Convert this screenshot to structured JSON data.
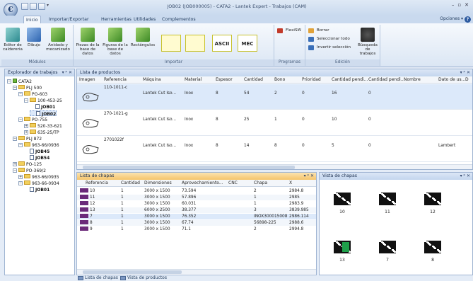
{
  "window": {
    "title": "JOB02 (JOB000005) - CATA2 - Lantek Expert - Trabajos (CAM)",
    "controls": [
      "–",
      "▫",
      "✕"
    ]
  },
  "qat": {
    "items": [
      "save-icon",
      "new-icon",
      "print-icon"
    ]
  },
  "ribbon_tabs": [
    "Inicio",
    "Importar/Exportar",
    "Herramientas",
    "Utilidades",
    "Complementos"
  ],
  "options_label": "Opciones",
  "help_label": "?",
  "groups": {
    "modulos": {
      "label": "Módulos",
      "buttons": [
        {
          "label": "Editor de\ncaldereria",
          "icon": "boiler-editor-icon"
        },
        {
          "label": "Dibujo",
          "icon": "drawing-icon"
        },
        {
          "label": "Anidado y\nmecanizado",
          "icon": "nesting-icon"
        }
      ]
    },
    "importar": {
      "label": "Importar",
      "buttons": [
        {
          "label": "Piezas de la\nbase de datos",
          "icon": "db-parts-icon"
        },
        {
          "label": "Figuras de la\nbase de datos",
          "icon": "db-figures-icon"
        },
        {
          "label": "Rectángulos",
          "icon": "rectangles-icon"
        }
      ],
      "big_icons": [
        "",
        "",
        "ASCII",
        "MEC"
      ]
    },
    "programas": {
      "label": "Programas",
      "flexsw": "FlexiSW"
    },
    "edicion": {
      "label": "Edición",
      "buttons": [
        "Borrar",
        "Seleccionar todo",
        "Invertir selección"
      ],
      "search": "Búsqueda de\ntrabajos"
    }
  },
  "explorer": {
    "title": "Explorador de trabajos",
    "nodes": [
      {
        "label": "CATA2",
        "level": 0,
        "type": "root",
        "exp": "−"
      },
      {
        "label": "PLJ 500",
        "level": 1,
        "type": "folder",
        "exp": "−"
      },
      {
        "label": "PO-603",
        "level": 2,
        "type": "folder",
        "exp": "−"
      },
      {
        "label": "100-453-25",
        "level": 3,
        "type": "folder",
        "exp": "−"
      },
      {
        "label": "JOB01",
        "level": 4,
        "type": "doc",
        "bold": true
      },
      {
        "label": "JOB02",
        "level": 4,
        "type": "doc",
        "bold": true,
        "selected": true
      },
      {
        "label": "PO-755",
        "level": 2,
        "type": "folder",
        "exp": "−"
      },
      {
        "label": "520-33-621",
        "level": 3,
        "type": "folder",
        "exp": "+"
      },
      {
        "label": "635-25/TP",
        "level": 3,
        "type": "folder",
        "exp": "+"
      },
      {
        "label": "PLJ 872",
        "level": 1,
        "type": "folder",
        "exp": "−"
      },
      {
        "label": "963-66/0936",
        "level": 2,
        "type": "folder",
        "exp": "−"
      },
      {
        "label": "JOB45",
        "level": 3,
        "type": "doc",
        "bold": true
      },
      {
        "label": "JOB54",
        "level": 3,
        "type": "doc",
        "bold": true
      },
      {
        "label": "PO-125",
        "level": 1,
        "type": "folder",
        "exp": "+"
      },
      {
        "label": "PO-369/2",
        "level": 1,
        "type": "folder",
        "exp": "−"
      },
      {
        "label": "963-66/0935",
        "level": 2,
        "type": "folder",
        "exp": "+"
      },
      {
        "label": "963-66-0934",
        "level": 2,
        "type": "folder",
        "exp": "−"
      },
      {
        "label": "JOB01",
        "level": 3,
        "type": "doc",
        "bold": true
      }
    ]
  },
  "products": {
    "title": "Lista de productos",
    "columns": [
      "Imagen",
      "Referencia",
      "Máquina",
      "Material",
      "Espesor",
      "Cantidad",
      "Bono",
      "Prioridad",
      "Cantidad pendi...",
      "Cantidad pendi...",
      "Nombre",
      "Dato de us...",
      "D"
    ],
    "rows": [
      {
        "ref": "110-1011-c",
        "maquina": "Lantek Cut Iso...",
        "material": "Inox",
        "espesor": "8",
        "cantidad": "54",
        "bono": "2",
        "prioridad": "0",
        "pend1": "16",
        "pend2": "0",
        "nombre": "",
        "dato": ""
      },
      {
        "ref": "270-1021-g",
        "maquina": "Lantek Cut Iso...",
        "material": "Inox",
        "espesor": "8",
        "cantidad": "25",
        "bono": "1",
        "prioridad": "0",
        "pend1": "10",
        "pend2": "0",
        "nombre": "",
        "dato": ""
      },
      {
        "ref": "2701022f",
        "maquina": "Lantek Cut Iso...",
        "material": "Inox",
        "espesor": "8",
        "cantidad": "14",
        "bono": "8",
        "prioridad": "0",
        "pend1": "5",
        "pend2": "0",
        "nombre": "",
        "dato": "Lambert"
      }
    ]
  },
  "sheets": {
    "title": "Lista de chapas",
    "columns": [
      "Referencia",
      "Cantidad",
      "Dimensiones",
      "Aprovechamiento...",
      "CNC",
      "Chapa",
      "X"
    ],
    "rows": [
      {
        "ref": "10",
        "cant": "1",
        "dim": "3000 x 1500",
        "aprov": "73.594",
        "cnc": "",
        "chapa": "2",
        "x": "2984.8"
      },
      {
        "ref": "11",
        "cant": "1",
        "dim": "3000 x 1500",
        "aprov": "57.896",
        "cnc": "",
        "chapa": "1",
        "x": "2985"
      },
      {
        "ref": "12",
        "cant": "1",
        "dim": "3000 x 1500",
        "aprov": "60.031",
        "cnc": "",
        "chapa": "1",
        "x": "2983.9"
      },
      {
        "ref": "13",
        "cant": "1",
        "dim": "6000 x 2500",
        "aprov": "38.377",
        "cnc": "",
        "chapa": "3",
        "x": "3839.985"
      },
      {
        "ref": "7",
        "cant": "1",
        "dim": "3000 x 1500",
        "aprov": "76.352",
        "cnc": "",
        "chapa": "INOX300015008",
        "x": "2986.114"
      },
      {
        "ref": "8",
        "cant": "1",
        "dim": "3000 x 1500",
        "aprov": "67.74",
        "cnc": "",
        "chapa": "56898-225",
        "x": "2988.6"
      },
      {
        "ref": "9",
        "cant": "1",
        "dim": "3000 x 1500",
        "aprov": "71.1",
        "cnc": "",
        "chapa": "2",
        "x": "2994.8"
      }
    ]
  },
  "sheet_view": {
    "title": "Vista de chapas",
    "items": [
      "10",
      "11",
      "12",
      "13",
      "7",
      "8"
    ]
  },
  "bottom_tabs": [
    "Lista de chapas",
    "Vista de productos"
  ],
  "colors": {
    "accent": "#2c5aa0",
    "active_header": "#f5c46b",
    "swatch": "#6b2a7a"
  }
}
